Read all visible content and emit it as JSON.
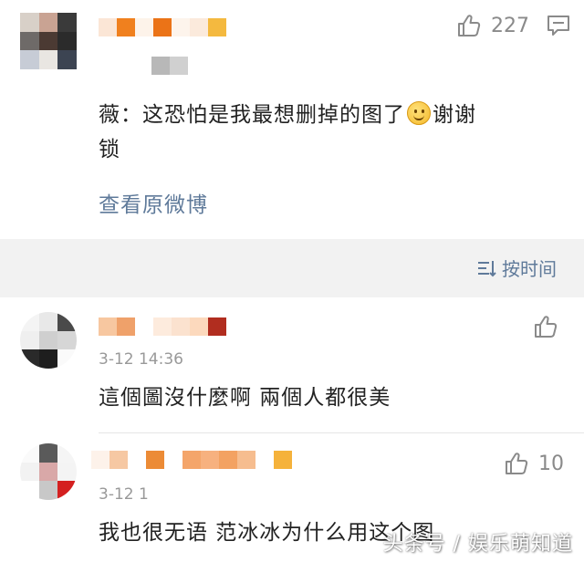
{
  "top_comment": {
    "like_count": "227",
    "text_line1": "薇：这恐怕是我最想删掉的图了",
    "text_line1_tail": "谢谢",
    "text_line2": "锁",
    "view_original": "查看原微博"
  },
  "sort": {
    "label": "按时间"
  },
  "comments": [
    {
      "time": "3-12 14:36",
      "text": "這個圖沒什麼啊 兩個人都很美",
      "like_count": ""
    },
    {
      "time": "3-12 1",
      "text": "我也很无语 范冰冰为什么用这个图",
      "like_count": "10"
    }
  ],
  "watermark": "头条号 / 娱乐萌知道",
  "colors": {
    "link": "#5f7a9a",
    "gap_background": "#f2f2f2",
    "icon_gray": "#8a8a8a"
  },
  "icons": [
    "thumbs-up-icon",
    "comment-icon",
    "sort-icon",
    "smiley-icon"
  ]
}
